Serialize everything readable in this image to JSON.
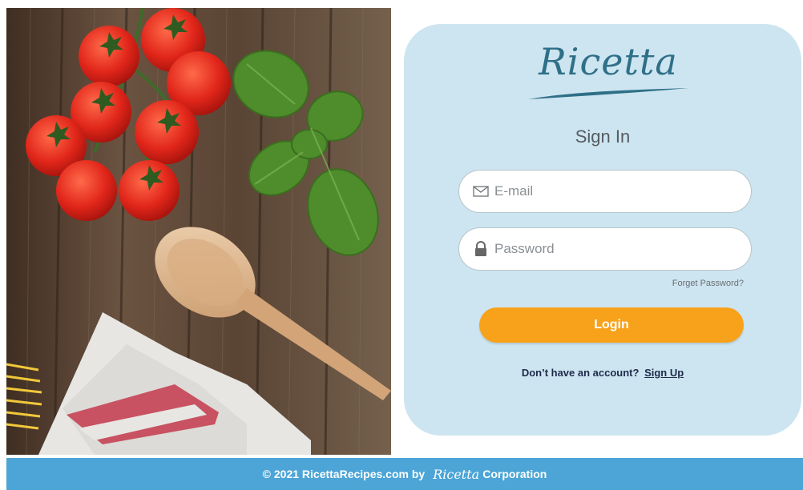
{
  "brand": {
    "name": "Ricetta"
  },
  "signin": {
    "title": "Sign In",
    "email_placeholder": "E-mail",
    "password_placeholder": "Password",
    "forgot_label": "Forget Password?",
    "login_label": "Login",
    "no_account_text": "Don’t have an account?",
    "signup_label": "Sign Up"
  },
  "footer": {
    "copyright": "© 2021 RicettaRecipes.com by",
    "logo": "Ricetta",
    "company": "Corporation"
  },
  "icons": {
    "email": "envelope-icon",
    "password": "lock-icon",
    "logo_mark": "whisk-icon"
  },
  "colors": {
    "card_bg": "#cde5f0",
    "brand": "#2f6f88",
    "button": "#f8a21b",
    "footer": "#4ca5d6"
  }
}
